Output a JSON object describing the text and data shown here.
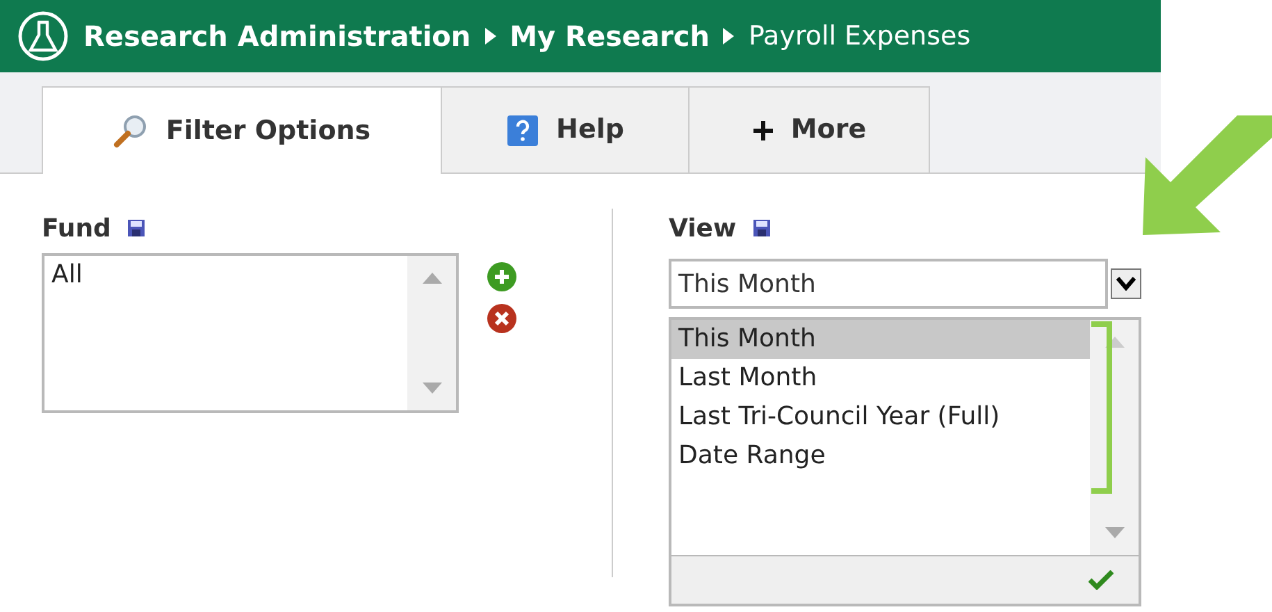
{
  "breadcrumb": [
    {
      "label": "Research Administration",
      "current": false
    },
    {
      "label": "My Research",
      "current": false
    },
    {
      "label": "Payroll Expenses",
      "current": true
    }
  ],
  "tabs": [
    {
      "label": "Filter Options",
      "kind": "search",
      "selected": true
    },
    {
      "label": "Help",
      "kind": "help",
      "selected": false
    },
    {
      "label": "More",
      "kind": "add",
      "selected": false
    }
  ],
  "fund": {
    "label": "Fund",
    "items": [
      {
        "label": "All",
        "selected": false
      }
    ]
  },
  "view": {
    "label": "View",
    "value": "This Month",
    "options": [
      {
        "label": "This Month",
        "selected": true
      },
      {
        "label": "Last Month",
        "selected": false
      },
      {
        "label": "Last Tri-Council Year (Full)",
        "selected": false
      },
      {
        "label": "Date Range",
        "selected": false
      }
    ]
  }
}
